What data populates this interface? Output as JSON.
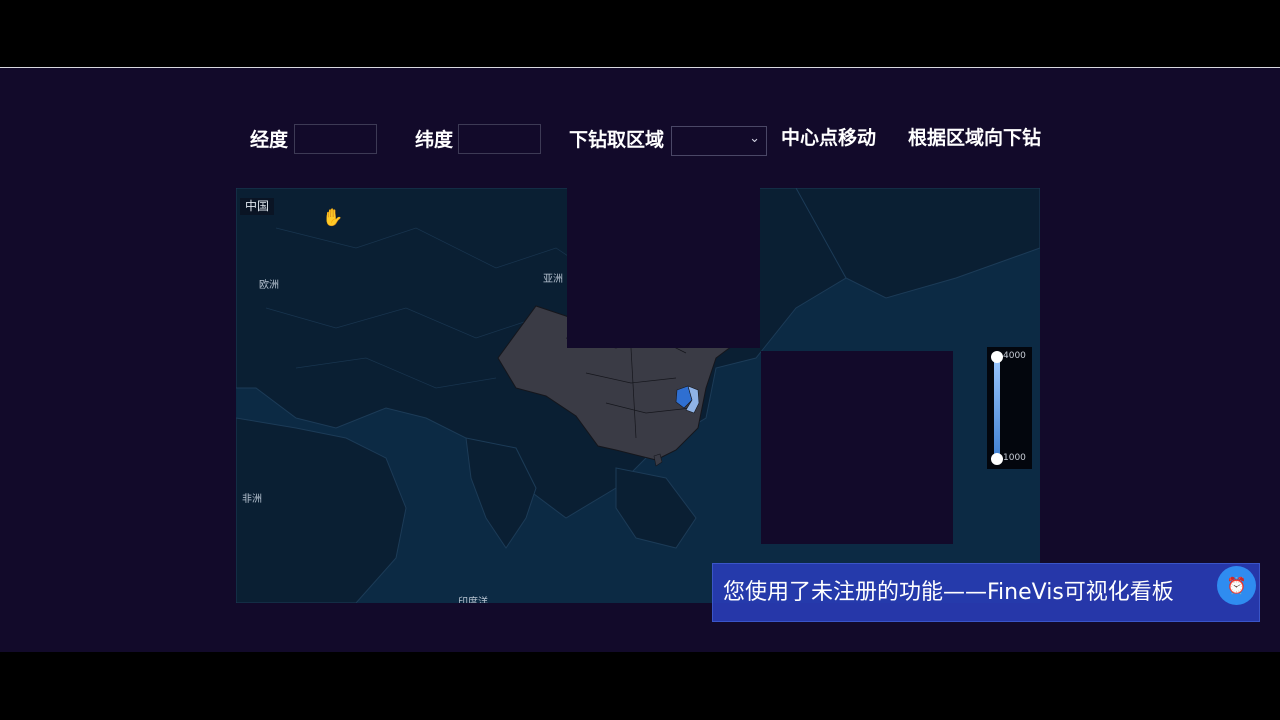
{
  "controls": {
    "longitude_label": "经度",
    "longitude_value": "",
    "latitude_label": "纬度",
    "latitude_value": "",
    "drill_label": "下钻取区域",
    "drill_selected": "",
    "center_move_button": "中心点移动",
    "drill_by_region_button": "根据区域向下钻"
  },
  "map": {
    "tag": "中国",
    "labels": {
      "europe": "欧洲",
      "asia": "亚洲",
      "africa": "非洲",
      "indian_ocean": "印度洋"
    },
    "icons": {
      "cursor": "hand-cursor-icon"
    },
    "colors": {
      "ocean": "#0c2a44",
      "land": "#0a1f33",
      "china": "#3a3b45",
      "highlight_a": "#2f6fd1",
      "highlight_b": "#8fb3e6"
    }
  },
  "legend": {
    "max_label": "4000",
    "min_label": "1000"
  },
  "notice": {
    "text": "您使用了未注册的功能——FineVis可视化看板",
    "icon": "alarm-clock-icon"
  }
}
